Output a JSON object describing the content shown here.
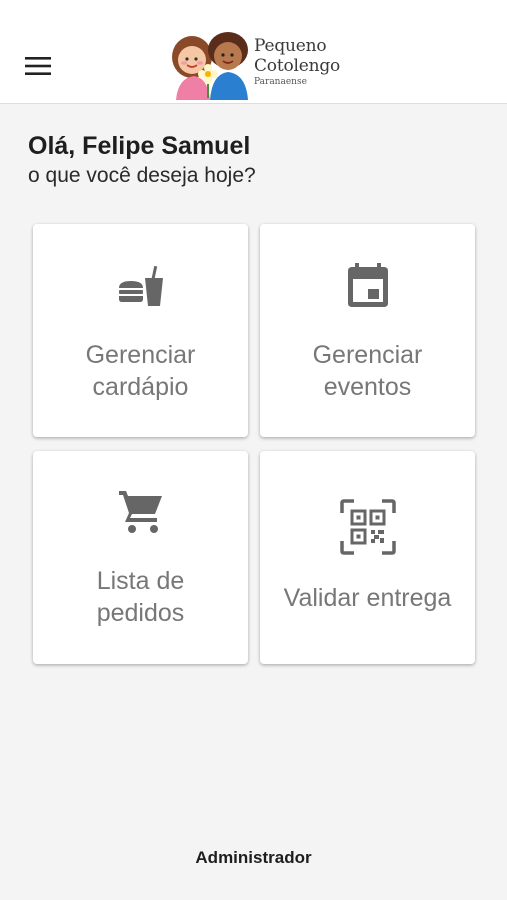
{
  "app_bar": {
    "menu_icon": "menu-icon",
    "logo": {
      "line1": "Pequeno",
      "line2": "Cotolengo",
      "line3": "Paranaense"
    }
  },
  "greeting": {
    "title": "Olá, Felipe Samuel",
    "subtitle": "o que você deseja hoje?"
  },
  "cards": [
    {
      "icon": "fastfood-icon",
      "line1": "Gerenciar",
      "line2": "cardápio"
    },
    {
      "icon": "calendar-icon",
      "line1": "Gerenciar",
      "line2": "eventos"
    },
    {
      "icon": "shopping-cart-icon",
      "line1": "Lista de",
      "line2": "pedidos"
    },
    {
      "icon": "qr-code-scanner-icon",
      "line1": "Validar entrega"
    }
  ],
  "footer": {
    "role_label": "Administrador"
  },
  "colors": {
    "background": "#f4f4f4",
    "card": "#ffffff",
    "icon": "#666666",
    "label": "#777777"
  }
}
